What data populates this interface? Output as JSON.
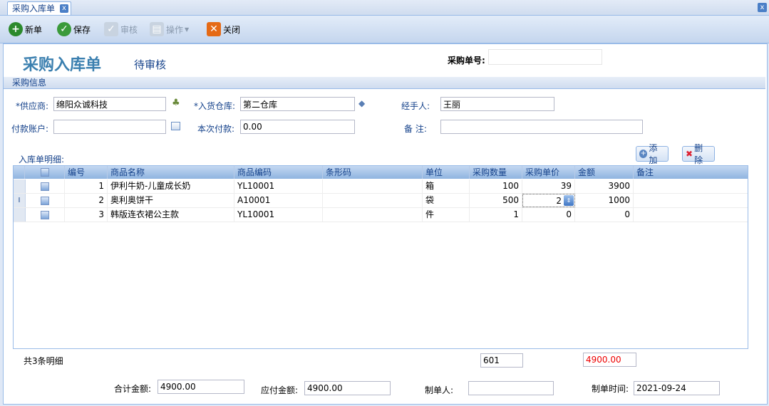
{
  "tab": {
    "title": "采购入库单",
    "close": "x"
  },
  "window": {
    "close": "x"
  },
  "toolbar": {
    "new_label": "新单",
    "save_label": "保存",
    "audit_label": "审核",
    "ops_label": "操作",
    "close_label": "关闭"
  },
  "header": {
    "title": "采购入库单",
    "status": "待审核",
    "order_no_label": "采购单号:",
    "order_no_value": ""
  },
  "section_title": "采购信息",
  "form": {
    "supplier_label": "*供应商:",
    "supplier_value": "绵阳众诚科技",
    "warehouse_label": "*入货仓库:",
    "warehouse_value": "第二仓库",
    "handler_label": "经手人:",
    "handler_value": "王丽",
    "account_label": "付款账户:",
    "account_value": "",
    "payment_label": "本次付款:",
    "payment_value": "0.00",
    "remark_label": "备 注:",
    "remark_value": ""
  },
  "detail": {
    "label": "入库单明细:",
    "add_label": "添加",
    "delete_label": "删除"
  },
  "grid": {
    "columns": [
      "编号",
      "商品名称",
      "商品编码",
      "条形码",
      "单位",
      "采购数量",
      "采购单价",
      "金额",
      "备注"
    ],
    "rows": [
      {
        "no": "1",
        "name": "伊利牛奶-儿童成长奶",
        "code": "YL10001",
        "barcode": "",
        "unit": "箱",
        "qty": "100",
        "price": "39",
        "amount": "3900",
        "remark": ""
      },
      {
        "no": "2",
        "name": "奥利奥饼干",
        "code": "A10001",
        "barcode": "",
        "unit": "袋",
        "qty": "500",
        "price": "2",
        "amount": "1000",
        "remark": ""
      },
      {
        "no": "3",
        "name": "韩版连衣裙公主款",
        "code": "YL10001",
        "barcode": "",
        "unit": "件",
        "qty": "1",
        "price": "0",
        "amount": "0",
        "remark": ""
      }
    ],
    "row_marker": "I"
  },
  "summary": {
    "count_text": "共3条明细",
    "qty_total": "601",
    "amount_total": "4900.00"
  },
  "footer": {
    "total_label": "合计金额:",
    "total_value": "4900.00",
    "payable_label": "应付金额:",
    "payable_value": "4900.00",
    "maker_label": "制单人:",
    "maker_value": "",
    "time_label": "制单时间:",
    "time_value": "2021-09-24"
  },
  "colors": {
    "accent": "#3a7faf",
    "panel": "#dfe8f6",
    "danger": "#e00000"
  }
}
